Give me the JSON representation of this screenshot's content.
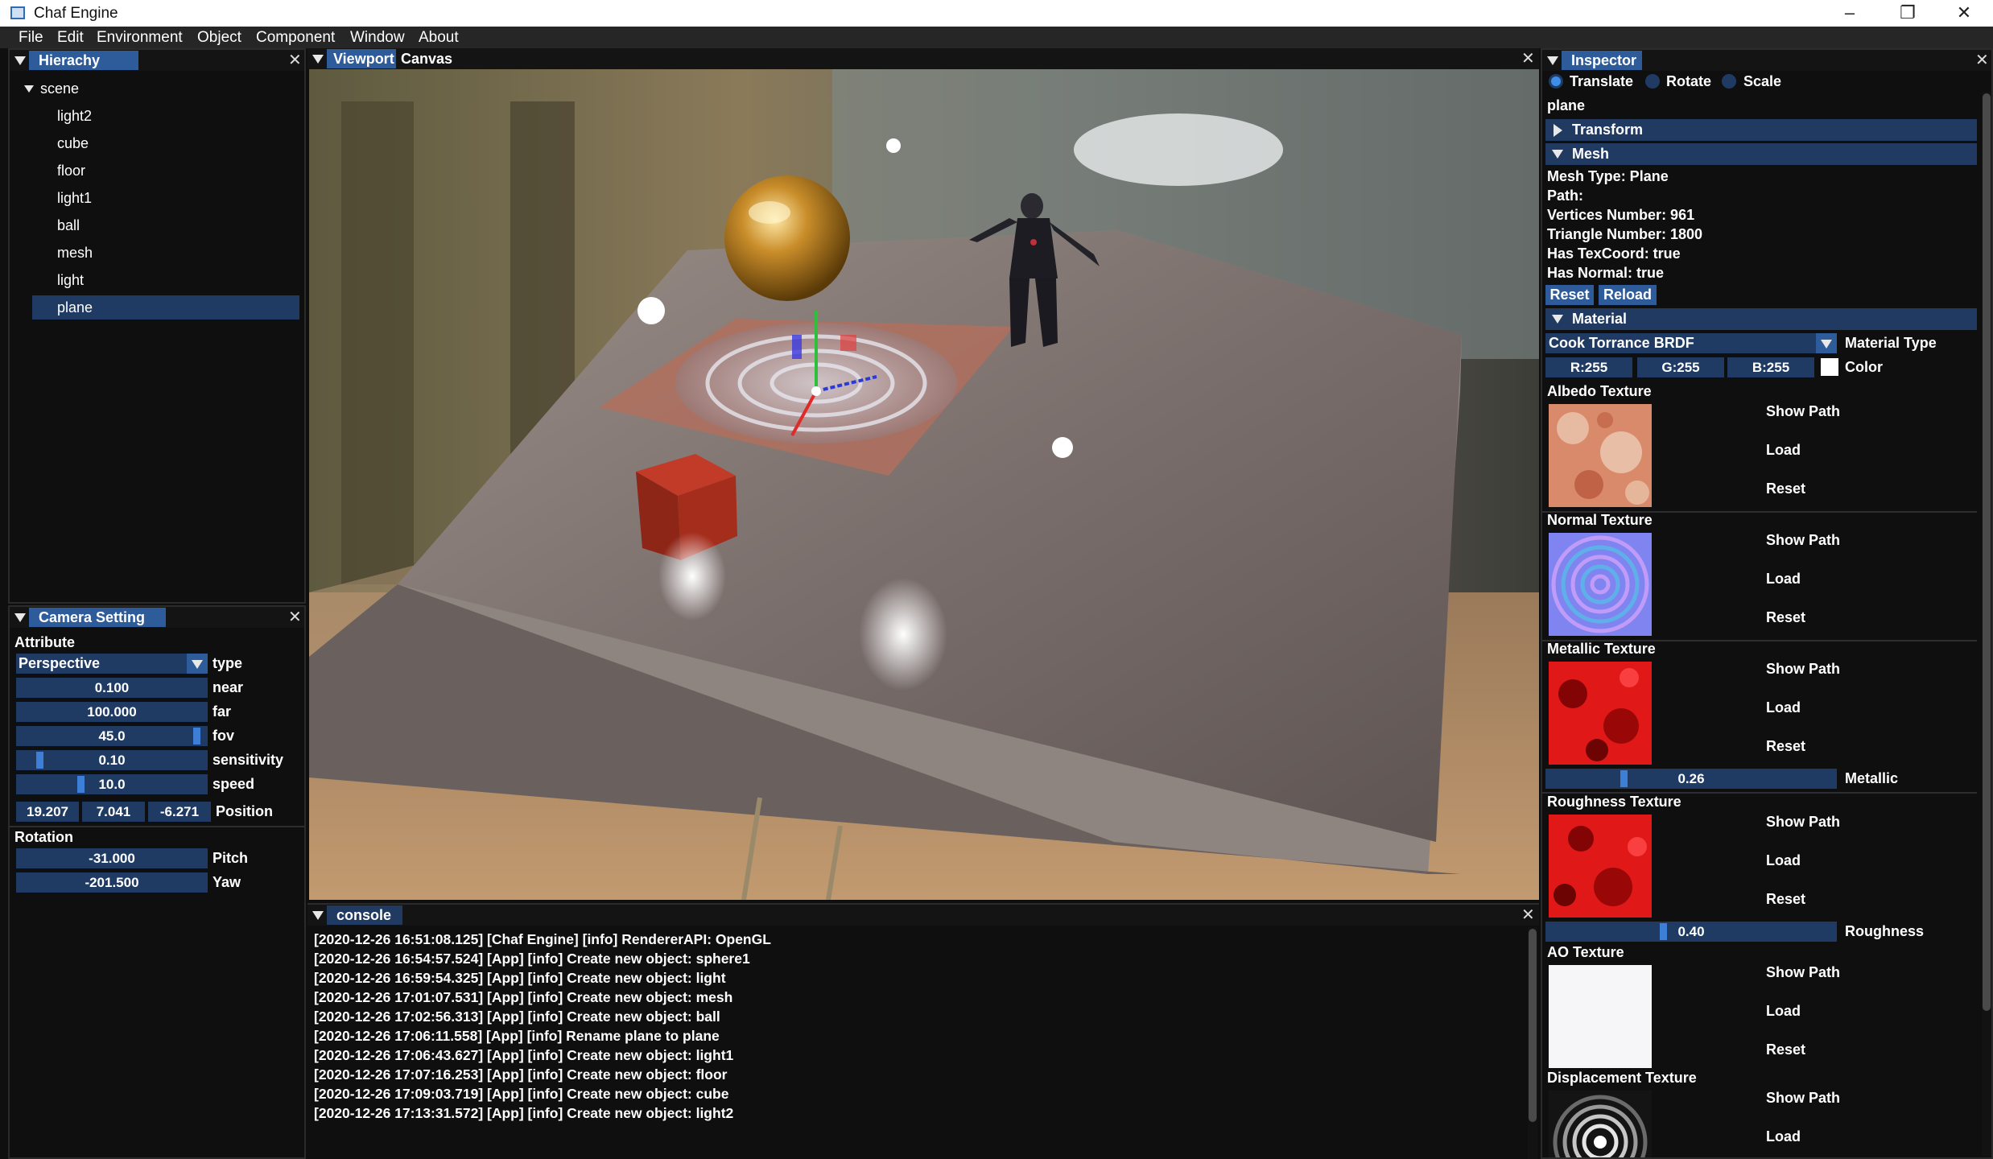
{
  "window": {
    "title": "Chaf Engine"
  },
  "menu": [
    "File",
    "Edit",
    "Environment",
    "Object",
    "Component",
    "Window",
    "About"
  ],
  "hierarchy": {
    "tab": "Hierachy",
    "root": "scene",
    "items": [
      "light2",
      "cube",
      "floor",
      "light1",
      "ball",
      "mesh",
      "light",
      "plane"
    ],
    "selected": "plane"
  },
  "camera": {
    "tab": "Camera Setting",
    "attribute_label": "Attribute",
    "type_value": "Perspective",
    "type_label": "type",
    "near": {
      "value": "0.100",
      "label": "near"
    },
    "far": {
      "value": "100.000",
      "label": "far"
    },
    "fov": {
      "value": "45.0",
      "label": "fov",
      "level": 0.97
    },
    "sensitivity": {
      "value": "0.10",
      "label": "sensitivity",
      "level": 0.1
    },
    "speed": {
      "value": "10.0",
      "label": "speed",
      "level": 0.33
    },
    "position": {
      "x": "19.207",
      "y": "7.041",
      "z": "-6.271",
      "label": "Position"
    },
    "rotation_label": "Rotation",
    "pitch": {
      "value": "-31.000",
      "label": "Pitch"
    },
    "yaw": {
      "value": "-201.500",
      "label": "Yaw"
    }
  },
  "viewport": {
    "tab_active": "Viewport",
    "tab_other": "Canvas"
  },
  "console": {
    "tab": "console",
    "lines": [
      "[2020-12-26 16:51:08.125] [Chaf Engine] [info] RendererAPI: OpenGL",
      "[2020-12-26 16:54:57.524] [App] [info] Create new object: sphere1",
      "[2020-12-26 16:59:54.325] [App] [info] Create new object: light",
      "[2020-12-26 17:01:07.531] [App] [info] Create new object: mesh",
      "[2020-12-26 17:02:56.313] [App] [info] Create new object: ball",
      "[2020-12-26 17:06:11.558] [App] [info] Rename plane to plane",
      "[2020-12-26 17:06:43.627] [App] [info] Create new object: light1",
      "[2020-12-26 17:07:16.253] [App] [info] Create new object: floor",
      "[2020-12-26 17:09:03.719] [App] [info] Create new object: cube",
      "[2020-12-26 17:13:31.572] [App] [info] Create new object: light2"
    ]
  },
  "inspector": {
    "tab": "Inspector",
    "gizmo": [
      "Translate",
      "Rotate",
      "Scale"
    ],
    "gizmo_selected": "Translate",
    "object_name": "plane",
    "transform_header": "Transform",
    "mesh_header": "Mesh",
    "mesh_info": [
      "Mesh Type: Plane",
      "Path:",
      "Vertices Number: 961",
      "Triangle Number: 1800",
      "Has TexCoord: true",
      "Has Normal: true"
    ],
    "reset_label": "Reset",
    "reload_label": "Reload",
    "material_header": "Material",
    "material_type_value": "Cook Torrance BRDF",
    "material_type_label": "Material Type",
    "color": {
      "r": "R:255",
      "g": "G:255",
      "b": "B:255",
      "label": "Color",
      "swatch": "#ffffff"
    },
    "texture_actions": [
      "Show Path",
      "Load",
      "Reset"
    ],
    "textures": {
      "albedo": "Albedo Texture",
      "normal": "Normal Texture",
      "metallic": "Metallic Texture",
      "roughness": "Roughness Texture",
      "ao": "AO Texture",
      "displacement": "Displacement Texture"
    },
    "metallic": {
      "value": "0.26",
      "label": "Metallic",
      "level": 0.26
    },
    "roughness": {
      "value": "0.40",
      "label": "Roughness",
      "level": 0.4
    }
  },
  "icons": {
    "collapse": "triangle-down-icon",
    "expand": "triangle-right-icon",
    "close": "close-icon",
    "radio": "radio-icon"
  },
  "colors": {
    "accent": "#2e5c9a",
    "field": "#1f3b63",
    "header": "#203a61",
    "grab": "#3d7fd6"
  }
}
